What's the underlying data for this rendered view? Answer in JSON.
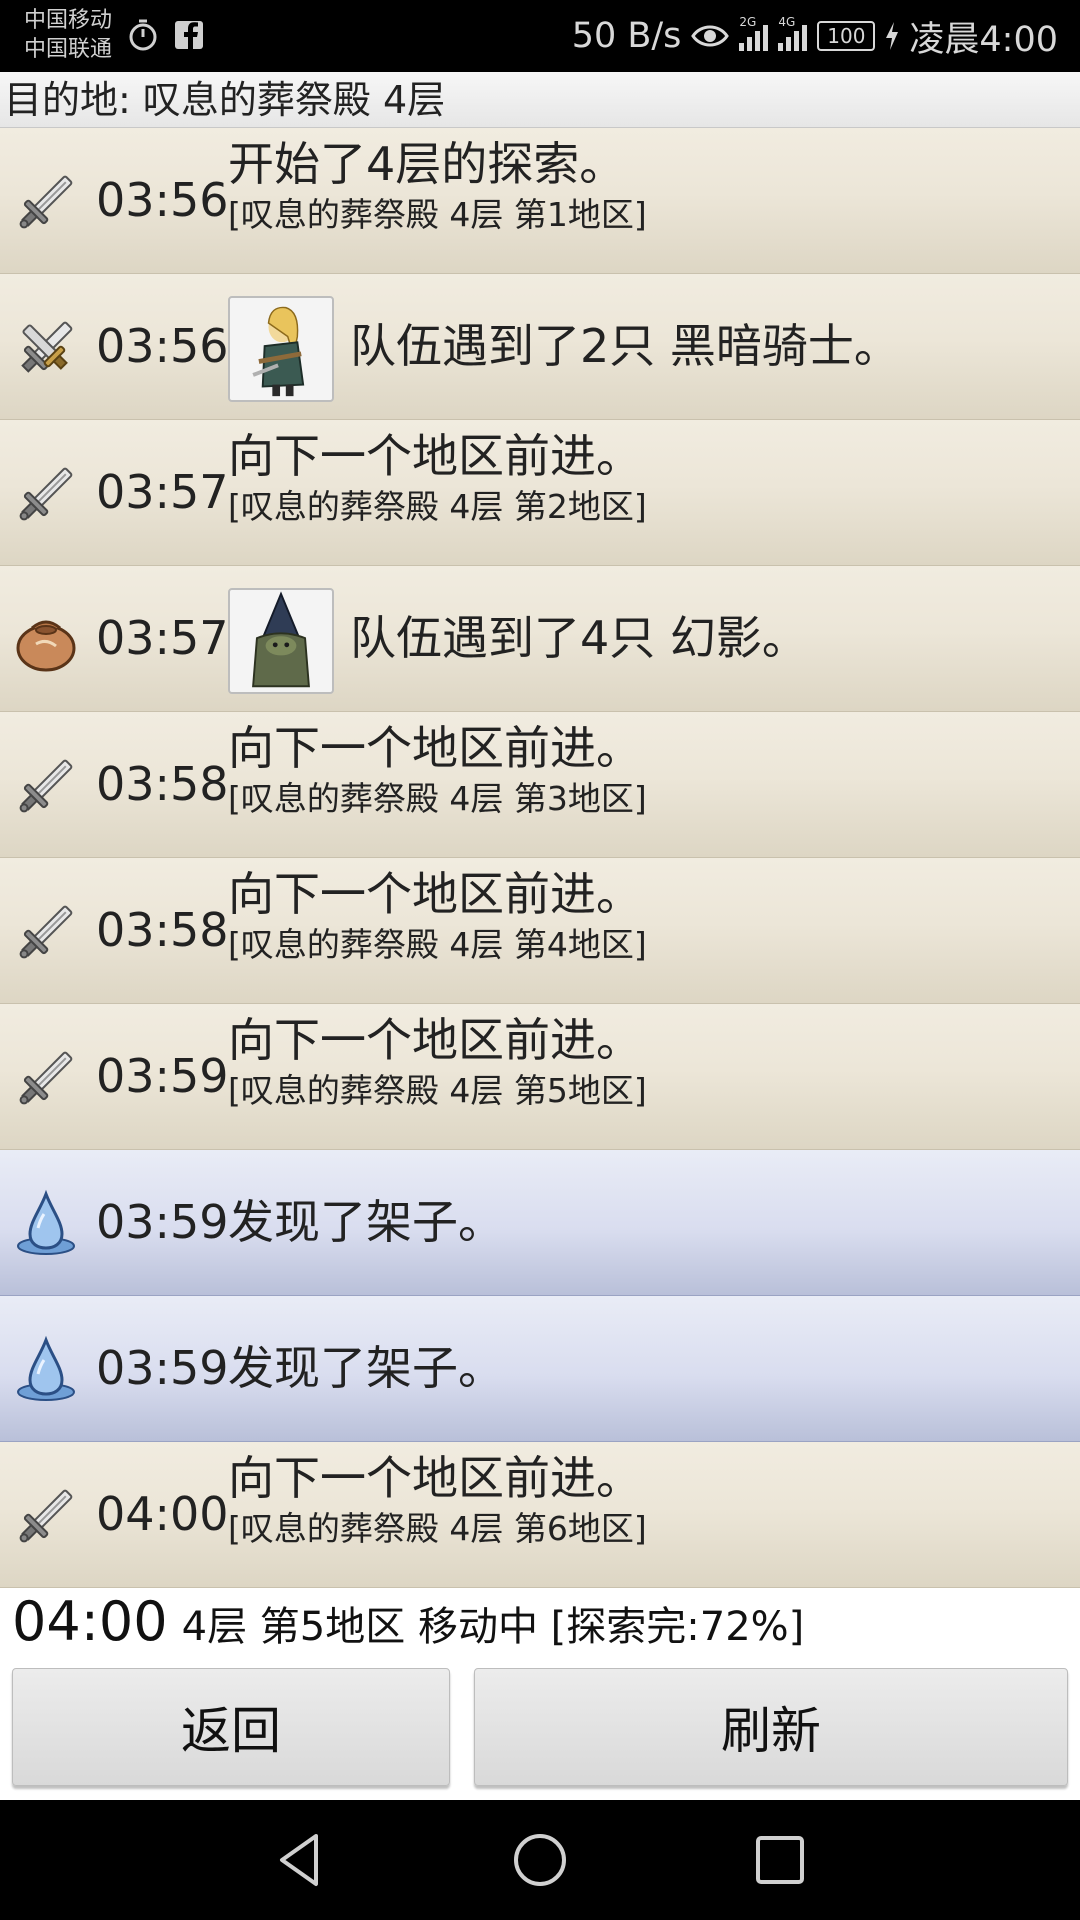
{
  "status_bar": {
    "carrier_1": "中国移动",
    "carrier_2": "中国联通",
    "net_speed": "50 B/s",
    "sim1_type": "2G",
    "sim2_type": "4G",
    "battery": "100",
    "time": "凌晨4:00"
  },
  "destination": "目的地: 叹息的葬祭殿 4层",
  "log": [
    {
      "icon": "sword-icon",
      "time": "03:56",
      "message": "开始了4层的探索。",
      "location": "[叹息的葬祭殿 4层 第1地区]",
      "type": "move"
    },
    {
      "icon": "crossed-swords-icon",
      "time": "03:56",
      "message": "队伍遇到了2只 黑暗骑士。",
      "portrait": "dark-knight-portrait",
      "type": "battle"
    },
    {
      "icon": "sword-icon",
      "time": "03:57",
      "message": "向下一个地区前进。",
      "location": "[叹息的葬祭殿 4层 第2地区]",
      "type": "move"
    },
    {
      "icon": "loot-bag-icon",
      "time": "03:57",
      "message": "队伍遇到了4只 幻影。",
      "portrait": "phantom-portrait",
      "type": "battle"
    },
    {
      "icon": "sword-icon",
      "time": "03:58",
      "message": "向下一个地区前进。",
      "location": "[叹息的葬祭殿 4层 第3地区]",
      "type": "move"
    },
    {
      "icon": "sword-icon",
      "time": "03:58",
      "message": "向下一个地区前进。",
      "location": "[叹息的葬祭殿 4层 第4地区]",
      "type": "move"
    },
    {
      "icon": "sword-icon",
      "time": "03:59",
      "message": "向下一个地区前进。",
      "location": "[叹息的葬祭殿 4层 第5地区]",
      "type": "move"
    },
    {
      "icon": "water-drop-icon",
      "time": "03:59",
      "message": "发现了架子。",
      "type": "found"
    },
    {
      "icon": "water-drop-icon",
      "time": "03:59",
      "message": "发现了架子。",
      "type": "found"
    },
    {
      "icon": "sword-icon",
      "time": "04:00",
      "message": "向下一个地区前进。",
      "location": "[叹息的葬祭殿 4层 第6地区]",
      "type": "move"
    }
  ],
  "footer": {
    "time": "04:00",
    "status": "4层 第5地区 移动中 [探索完:72%]"
  },
  "buttons": {
    "back": "返回",
    "refresh": "刷新"
  }
}
